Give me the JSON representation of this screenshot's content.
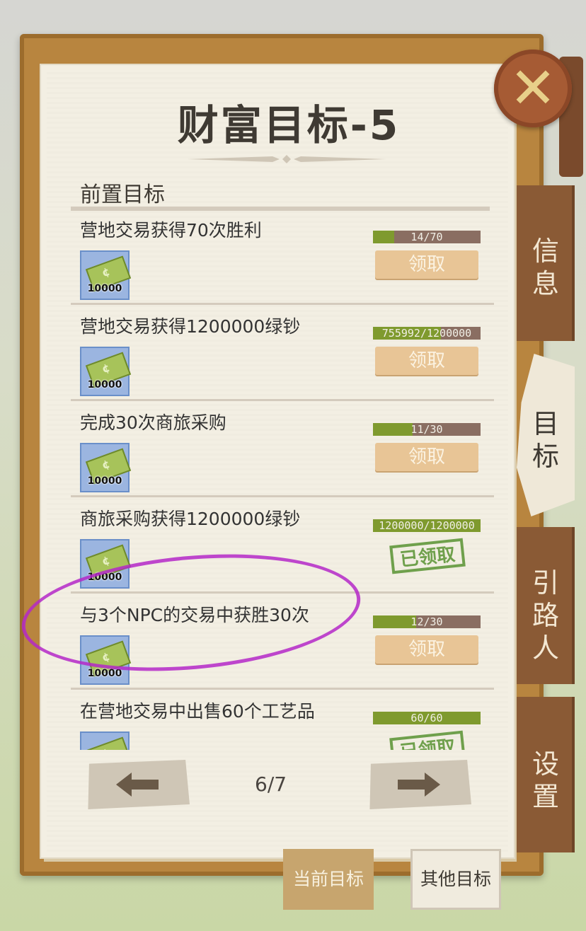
{
  "title": "财富目标-5",
  "section_label": "前置目标",
  "tasks": [
    {
      "name": "营地交易获得70次胜利",
      "progress_text": "14/70",
      "progress": 0.2,
      "reward_amount": "10000",
      "status": "领取"
    },
    {
      "name": "营地交易获得1200000绿钞",
      "progress_text": "755992/1200000",
      "progress": 0.63,
      "reward_amount": "10000",
      "status": "领取"
    },
    {
      "name": "完成30次商旅采购",
      "progress_text": "11/30",
      "progress": 0.37,
      "reward_amount": "10000",
      "status": "领取"
    },
    {
      "name": "商旅采购获得1200000绿钞",
      "progress_text": "1200000/1200000",
      "progress": 1.0,
      "reward_amount": "10000",
      "status": "已领取"
    },
    {
      "name": "与3个NPC的交易中获胜30次",
      "progress_text": "12/30",
      "progress": 0.4,
      "reward_amount": "10000",
      "status": "领取"
    },
    {
      "name": "在营地交易中出售60个工艺品",
      "progress_text": "60/60",
      "progress": 1.0,
      "reward_amount": "",
      "status": "已领取"
    }
  ],
  "pager": {
    "page_text": "6/7"
  },
  "side_tabs": {
    "info": "信息",
    "goals": "目标",
    "guide": "引路人",
    "settings": "设置"
  },
  "bottom_tabs": {
    "current": "当前目标",
    "other": "其他目标"
  },
  "colors": {
    "progress_fill": "#7f9a2e",
    "progress_track": "#8a6e62",
    "tab_brown": "#8a5a35",
    "circle_annotation": "#b428c8"
  }
}
